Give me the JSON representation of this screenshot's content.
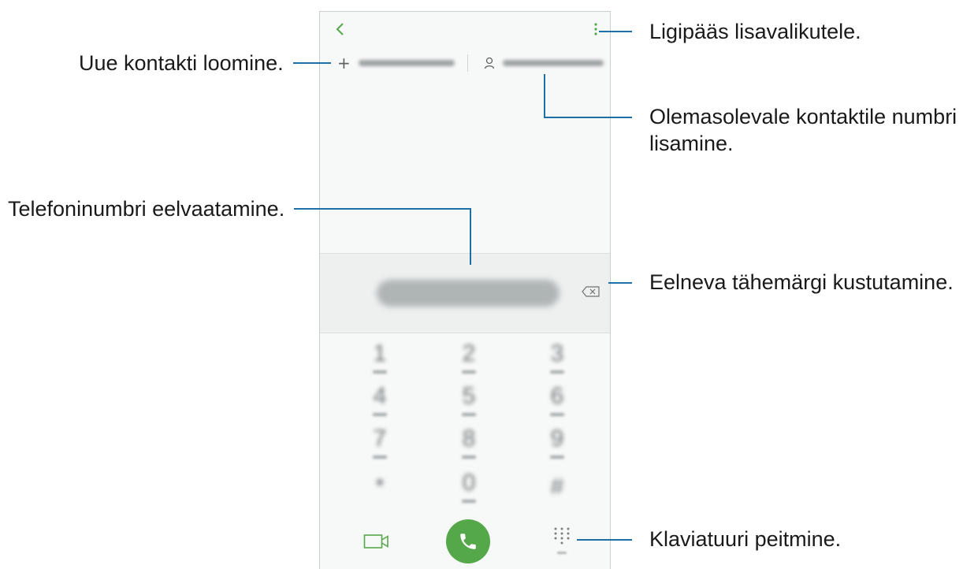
{
  "callouts": {
    "more_options": "Ligipääs lisavalikutele.",
    "create_contact": "Uue kontakti loomine.",
    "update_existing_line1": "Olemasolevale kontaktile numbri",
    "update_existing_line2": "lisamine.",
    "number_preview": "Telefoninumbri eelvaatamine.",
    "delete_char": "Eelneva tähemärgi kustutamine.",
    "hide_keypad": "Klaviatuuri peitmine."
  },
  "phone": {
    "actions": {
      "create_contact_icon": "plus-icon",
      "update_existing_icon": "person-icon"
    },
    "keypad": [
      {
        "digit": "1"
      },
      {
        "digit": "2"
      },
      {
        "digit": "3"
      },
      {
        "digit": "4"
      },
      {
        "digit": "5"
      },
      {
        "digit": "6"
      },
      {
        "digit": "7"
      },
      {
        "digit": "8"
      },
      {
        "digit": "9"
      },
      {
        "digit": "*"
      },
      {
        "digit": "0"
      },
      {
        "digit": "#"
      }
    ],
    "icons": {
      "back": "back-arrow-icon",
      "more": "more-options-icon",
      "backspace": "backspace-icon",
      "video": "video-call-icon",
      "call": "phone-icon",
      "keypad_toggle": "keypad-icon"
    }
  },
  "colors": {
    "accent": "#55a84a",
    "callout_line": "#1e6ea8",
    "screen_bg": "#f7f8f8"
  }
}
